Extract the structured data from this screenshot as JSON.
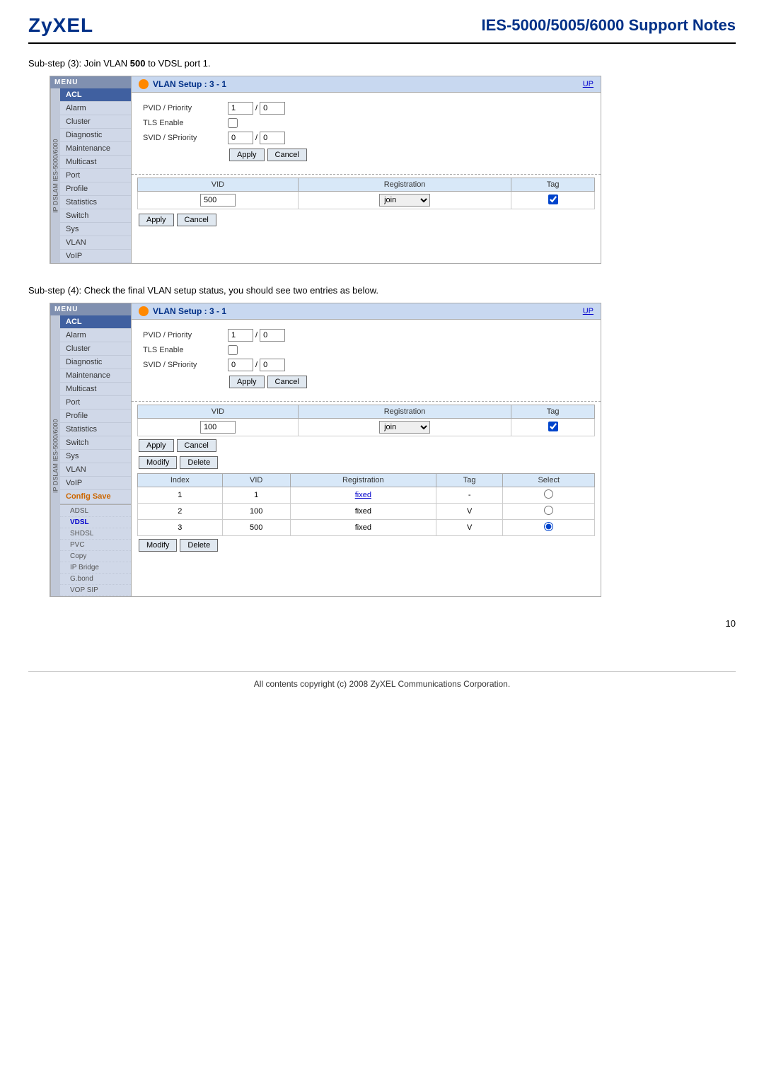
{
  "header": {
    "logo": "ZyXEL",
    "title": "IES-5000/5005/6000 Support Notes"
  },
  "substep3": {
    "text": "Sub-step (3): Join VLAN ",
    "bold": "500",
    "text2": " to VDSL port 1."
  },
  "substep4": {
    "text": "Sub-step (4): Check the final VLAN setup status, you should see two entries as below."
  },
  "sidebar": {
    "header": "MENU",
    "rotated_label": "IP DSLAM IES-5000/6000",
    "items": [
      {
        "label": "ACL",
        "active": true
      },
      {
        "label": "Alarm"
      },
      {
        "label": "Cluster"
      },
      {
        "label": "Diagnostic"
      },
      {
        "label": "Maintenance"
      },
      {
        "label": "Multicast"
      },
      {
        "label": "Port"
      },
      {
        "label": "Profile"
      },
      {
        "label": "Statistics"
      },
      {
        "label": "Switch"
      },
      {
        "label": "Sys"
      },
      {
        "label": "VLAN"
      },
      {
        "label": "VoIP"
      }
    ]
  },
  "sidebar2": {
    "header": "MENU",
    "items_top": [
      {
        "label": "ACL",
        "active": true
      },
      {
        "label": "Alarm"
      },
      {
        "label": "Cluster"
      },
      {
        "label": "Diagnostic"
      },
      {
        "label": "Maintenance"
      },
      {
        "label": "Multicast"
      },
      {
        "label": "Port"
      },
      {
        "label": "Profile"
      },
      {
        "label": "Statistics"
      },
      {
        "label": "Switch"
      },
      {
        "label": "Sys"
      },
      {
        "label": "VLAN"
      },
      {
        "label": "VoIP"
      },
      {
        "label": "Config Save",
        "orange": true
      }
    ],
    "items_sub": [
      {
        "label": "ADSL"
      },
      {
        "label": "VDSL",
        "active": true
      },
      {
        "label": "SHDSL"
      },
      {
        "label": "PVC"
      },
      {
        "label": "Copy"
      },
      {
        "label": "IP Bridge"
      },
      {
        "label": "G.bond"
      },
      {
        "label": "VOP SIP"
      }
    ]
  },
  "panel1": {
    "vlan_title": "VLAN Setup :  3 - 1",
    "up_label": "UP",
    "pvid_label": "PVID / Priority",
    "pvid_val": "1",
    "pvid_priority": "0",
    "tls_label": "TLS Enable",
    "svid_label": "SVID / SPriority",
    "svid_val": "0",
    "svid_priority": "0",
    "apply_btn": "Apply",
    "cancel_btn": "Cancel",
    "table_headers": [
      "VID",
      "Registration",
      "Tag"
    ],
    "vid_val": "500",
    "registration_val": "join",
    "tag_checked": true,
    "apply_btn2": "Apply",
    "cancel_btn2": "Cancel"
  },
  "panel2": {
    "vlan_title": "VLAN Setup :  3 - 1",
    "up_label": "UP",
    "pvid_label": "PVID / Priority",
    "pvid_val": "1",
    "pvid_priority": "0",
    "tls_label": "TLS Enable",
    "svid_label": "SVID / SPriority",
    "svid_val": "0",
    "svid_priority": "0",
    "apply_btn": "Apply",
    "cancel_btn": "Cancel",
    "table_headers_top": [
      "VID",
      "Registration",
      "Tag"
    ],
    "vid_val": "100",
    "registration_val": "join",
    "tag_checked": true,
    "apply_btn2": "Apply",
    "cancel_btn2": "Cancel",
    "modify_btn": "Modify",
    "delete_btn": "Delete",
    "table_headers": [
      "Index",
      "VID",
      "Registration",
      "Tag",
      "Select"
    ],
    "table_rows": [
      {
        "index": "1",
        "vid": "1",
        "registration": "fixed",
        "tag": "-",
        "radio": "normal"
      },
      {
        "index": "2",
        "vid": "100",
        "registration": "fixed",
        "tag": "V",
        "radio": "normal"
      },
      {
        "index": "3",
        "vid": "500",
        "registration": "fixed",
        "tag": "V",
        "radio": "selected"
      }
    ],
    "modify_btn2": "Modify",
    "delete_btn2": "Delete"
  },
  "footer": {
    "text": "All contents copyright (c) 2008 ZyXEL Communications Corporation.",
    "page": "10"
  }
}
